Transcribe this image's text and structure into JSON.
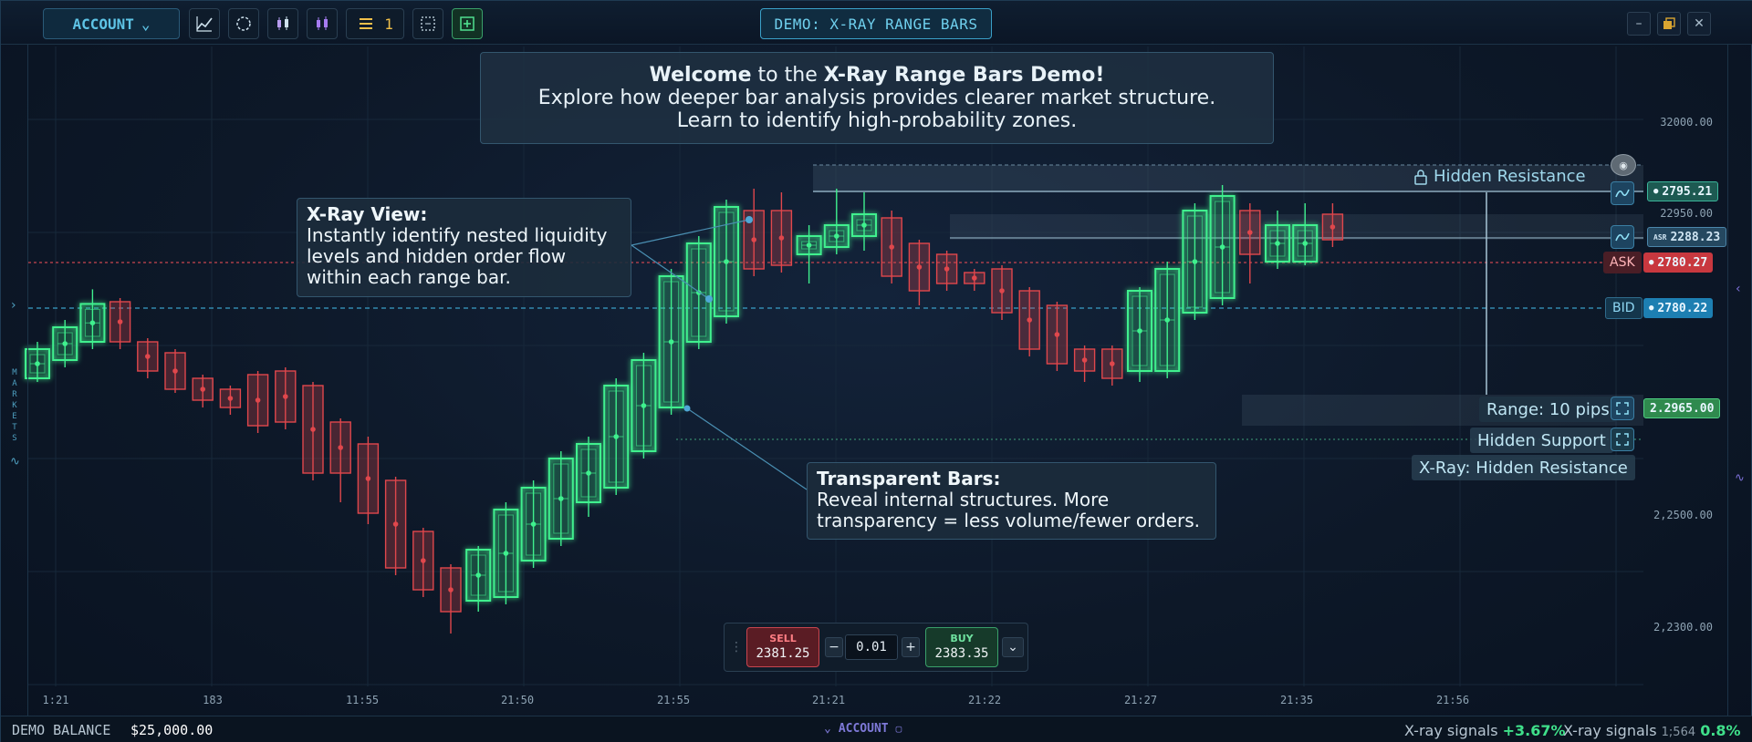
{
  "toolbar": {
    "account_label": "ACCOUNT",
    "indicator_count": "1",
    "title": "DEMO: X-RAY RANGE BARS",
    "icons": [
      "line-chart-icon",
      "crosshair-icon",
      "candles-icon",
      "candles-purple-icon",
      "list-icon",
      "select-icon",
      "add-panel-icon"
    ]
  },
  "window": {
    "minimize": "–",
    "close": "✕"
  },
  "welcome": {
    "bold1": "Welcome",
    "mid1": " to the ",
    "bold2": "X-Ray Range Bars Demo!",
    "line2": "Explore how deeper bar analysis provides clearer market structure.",
    "line3": "Learn to identify high-probability zones."
  },
  "xray_callout": {
    "heading": "X-Ray View:",
    "body": "Instantly identify nested liquidity levels and hidden order flow within each range bar."
  },
  "transparent_callout": {
    "heading": "Transparent Bars:",
    "body": "Reveal internal structures. More transparency = less volume/fewer orders."
  },
  "annotations": {
    "hidden_resistance": "Hidden Resistance",
    "range": "Range: 10 pips",
    "hidden_support": "Hidden Support",
    "xray_resistance": "X-Ray: Hidden Resistance"
  },
  "price_tags": {
    "resistance": "2795.21",
    "asr": "2288.23",
    "asr_label": "ASR",
    "ask_label": "ASK",
    "ask": "2780.27",
    "bid_label": "BID",
    "bid": "2780.22",
    "range": "2.2965.00"
  },
  "y_axis": [
    "32000.00",
    "22950.00",
    "2,2500.00",
    "2,2300.00"
  ],
  "x_axis": [
    "1:21",
    "183",
    "11:55",
    "21:50",
    "21:55",
    "21:21",
    "21:22",
    "21:27",
    "21:35",
    "21:56"
  ],
  "order_panel": {
    "sell_label": "SELL",
    "sell_price": "2381.25",
    "qty": "0.01",
    "minus": "−",
    "plus": "+",
    "buy_label": "BUY",
    "buy_price": "2383.35"
  },
  "left_strip": "MARKETS",
  "bottom": {
    "balance_label": "DEMO BALANCE",
    "balance_value": "$25,000.00",
    "account": "ACCOUNT",
    "sig1_label": "X-ray signals ",
    "sig1_value": "+3.67%",
    "sig2_label": "X-ray signals",
    "sig2_extra": "1;564",
    "sig2_value": "0.8%"
  },
  "colors": {
    "bull": "#3ff08e",
    "bear": "#e0474c",
    "accent": "#4fc4e8",
    "ask_line": "#c8454f",
    "bid_line": "#3a9fc8"
  },
  "chart_data": {
    "type": "candlestick-range-bars",
    "candles": [
      {
        "d": "up",
        "o": 2470,
        "c": 2510,
        "h": 2520,
        "l": 2465
      },
      {
        "d": "up",
        "o": 2495,
        "c": 2540,
        "h": 2550,
        "l": 2485
      },
      {
        "d": "up",
        "o": 2520,
        "c": 2572,
        "h": 2592,
        "l": 2510
      },
      {
        "d": "down",
        "o": 2575,
        "c": 2520,
        "h": 2580,
        "l": 2510
      },
      {
        "d": "down",
        "o": 2520,
        "c": 2480,
        "h": 2525,
        "l": 2470
      },
      {
        "d": "down",
        "o": 2505,
        "c": 2455,
        "h": 2510,
        "l": 2450
      },
      {
        "d": "down",
        "o": 2470,
        "c": 2440,
        "h": 2475,
        "l": 2430
      },
      {
        "d": "down",
        "o": 2455,
        "c": 2430,
        "h": 2460,
        "l": 2420
      },
      {
        "d": "down",
        "o": 2475,
        "c": 2405,
        "h": 2480,
        "l": 2395
      },
      {
        "d": "down",
        "o": 2480,
        "c": 2410,
        "h": 2485,
        "l": 2400
      },
      {
        "d": "down",
        "o": 2460,
        "c": 2340,
        "h": 2465,
        "l": 2330
      },
      {
        "d": "down",
        "o": 2410,
        "c": 2340,
        "h": 2415,
        "l": 2300
      },
      {
        "d": "down",
        "o": 2380,
        "c": 2285,
        "h": 2390,
        "l": 2270
      },
      {
        "d": "down",
        "o": 2330,
        "c": 2210,
        "h": 2335,
        "l": 2200
      },
      {
        "d": "down",
        "o": 2260,
        "c": 2180,
        "h": 2265,
        "l": 2170
      },
      {
        "d": "down",
        "o": 2210,
        "c": 2150,
        "h": 2215,
        "l": 2120
      },
      {
        "d": "up",
        "o": 2165,
        "c": 2235,
        "h": 2240,
        "l": 2150
      },
      {
        "d": "up",
        "o": 2170,
        "c": 2290,
        "h": 2300,
        "l": 2160
      },
      {
        "d": "up",
        "o": 2220,
        "c": 2320,
        "h": 2330,
        "l": 2210
      },
      {
        "d": "up",
        "o": 2250,
        "c": 2360,
        "h": 2370,
        "l": 2240
      },
      {
        "d": "up",
        "o": 2300,
        "c": 2380,
        "h": 2390,
        "l": 2280
      },
      {
        "d": "up",
        "o": 2320,
        "c": 2460,
        "h": 2470,
        "l": 2310
      },
      {
        "d": "up",
        "o": 2370,
        "c": 2495,
        "h": 2505,
        "l": 2360
      },
      {
        "d": "up",
        "o": 2430,
        "c": 2610,
        "h": 2620,
        "l": 2420
      },
      {
        "d": "up",
        "o": 2520,
        "c": 2655,
        "h": 2665,
        "l": 2510
      },
      {
        "d": "up",
        "o": 2555,
        "c": 2705,
        "h": 2715,
        "l": 2545
      },
      {
        "d": "down",
        "o": 2700,
        "c": 2620,
        "h": 2730,
        "l": 2610
      },
      {
        "d": "down",
        "o": 2700,
        "c": 2625,
        "h": 2725,
        "l": 2615
      },
      {
        "d": "up",
        "o": 2640,
        "c": 2665,
        "h": 2680,
        "l": 2600
      },
      {
        "d": "up",
        "o": 2650,
        "c": 2680,
        "h": 2730,
        "l": 2640
      },
      {
        "d": "up",
        "o": 2665,
        "c": 2695,
        "h": 2725,
        "l": 2645
      },
      {
        "d": "down",
        "o": 2690,
        "c": 2610,
        "h": 2700,
        "l": 2600
      },
      {
        "d": "down",
        "o": 2655,
        "c": 2590,
        "h": 2660,
        "l": 2570
      },
      {
        "d": "down",
        "o": 2640,
        "c": 2600,
        "h": 2645,
        "l": 2590
      },
      {
        "d": "down",
        "o": 2615,
        "c": 2600,
        "h": 2620,
        "l": 2590
      },
      {
        "d": "down",
        "o": 2620,
        "c": 2560,
        "h": 2625,
        "l": 2550
      },
      {
        "d": "down",
        "o": 2590,
        "c": 2510,
        "h": 2595,
        "l": 2500
      },
      {
        "d": "down",
        "o": 2570,
        "c": 2490,
        "h": 2575,
        "l": 2480
      },
      {
        "d": "down",
        "o": 2510,
        "c": 2480,
        "h": 2515,
        "l": 2465
      },
      {
        "d": "down",
        "o": 2510,
        "c": 2470,
        "h": 2515,
        "l": 2460
      },
      {
        "d": "up",
        "o": 2480,
        "c": 2590,
        "h": 2595,
        "l": 2465
      },
      {
        "d": "up",
        "o": 2480,
        "c": 2620,
        "h": 2630,
        "l": 2470
      },
      {
        "d": "up",
        "o": 2560,
        "c": 2700,
        "h": 2710,
        "l": 2550
      },
      {
        "d": "up",
        "o": 2580,
        "c": 2720,
        "h": 2735,
        "l": 2570
      },
      {
        "d": "down",
        "o": 2700,
        "c": 2640,
        "h": 2710,
        "l": 2600
      },
      {
        "d": "up",
        "o": 2630,
        "c": 2680,
        "h": 2700,
        "l": 2620
      },
      {
        "d": "up",
        "o": 2630,
        "c": 2680,
        "h": 2710,
        "l": 2625
      },
      {
        "d": "down",
        "o": 2695,
        "c": 2660,
        "h": 2710,
        "l": 2650
      }
    ]
  }
}
